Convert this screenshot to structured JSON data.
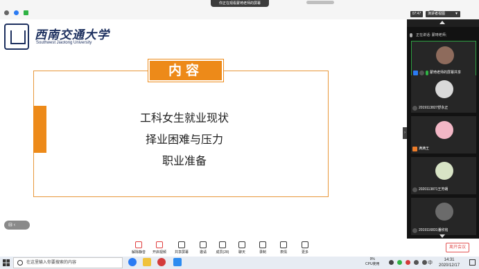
{
  "window": {
    "sharing_status": "你正在观看蒙琦老师的屏幕",
    "time": "07:47",
    "view_button": "演讲者视图",
    "view_chevron": "▼",
    "controls": [
      "—",
      "☐",
      "✕"
    ]
  },
  "slide": {
    "logo_cn": "西南交通大学",
    "logo_en": "Southwest Jiaotong University",
    "title": "内容",
    "items": [
      "工科女生就业现状",
      "择业困难与压力",
      "职业准备"
    ]
  },
  "float_control": "⊟ ‹",
  "sidebar": {
    "speaking": "正在讲话: 蒙琦老师;",
    "collapse": "›",
    "participants": [
      {
        "name": "蒙琦老师的屏幕共享",
        "avatar_color": "#8e6b5c",
        "active": true
      },
      {
        "name": "2019113827舒永正",
        "avatar_color": "#d9d9d9",
        "active": false
      },
      {
        "name": "满满王",
        "avatar_color": "#f3b7c6",
        "active": false
      },
      {
        "name": "2020113871王芳蜻",
        "avatar_color": "#d8e4c6",
        "active": false
      },
      {
        "name": "2019116831潘欣铭",
        "avatar_color": "#6b6b6b",
        "active": false
      }
    ]
  },
  "toolbar": {
    "tools": [
      {
        "label": "解除静音",
        "icon": "mic-muted-icon",
        "color": "#e03c3c"
      },
      {
        "label": "开启视频",
        "icon": "video-off-icon",
        "color": "#e03c3c"
      },
      {
        "label": "共享屏幕",
        "icon": "share-screen-icon",
        "color": "#333333"
      },
      {
        "label": "邀请",
        "icon": "invite-icon",
        "color": "#333333"
      },
      {
        "label": "成员(28)",
        "icon": "members-icon",
        "color": "#333333"
      },
      {
        "label": "聊天",
        "icon": "chat-icon",
        "color": "#333333"
      },
      {
        "label": "录制",
        "icon": "record-icon",
        "color": "#333333"
      },
      {
        "label": "表情",
        "icon": "emoji-icon",
        "color": "#333333"
      },
      {
        "label": "更多",
        "icon": "more-icon",
        "color": "#333333"
      }
    ],
    "leave_label": "离开会议"
  },
  "taskbar": {
    "search_placeholder": "在这里输入你要搜索的内容",
    "cpu_percent": "9%",
    "cpu_label": "CPU使用",
    "ime": "中",
    "time": "14:31",
    "date": "2020/12/17"
  }
}
